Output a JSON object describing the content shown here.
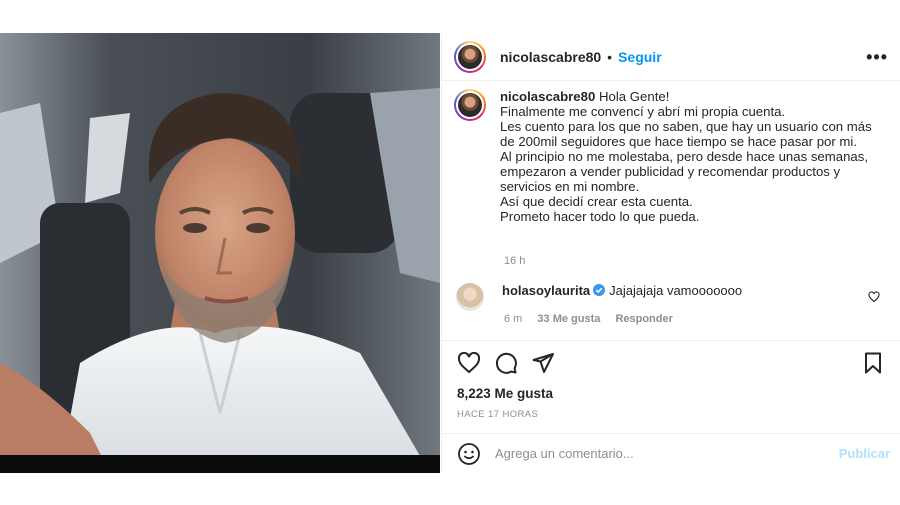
{
  "post": {
    "username": "nicolascabre80",
    "follow_label": "Seguir",
    "more_label": "•••",
    "separator": "•",
    "caption": {
      "username": "nicolascabre80",
      "lines": [
        "Hola Gente!",
        "Finalmente me convencí y abrí mi propia cuenta.",
        "Les cuento para los que no saben, que hay un usuario con más de 200mil seguidores que hace tiempo se hace pasar por mi.",
        "Al principio no me molestaba, pero desde hace unas semanas, empezaron a vender publicidad y recomendar productos y servicios en mi nombre.",
        "Así que decidí crear esta cuenta.",
        "Prometo hacer todo lo que pueda."
      ],
      "time": "16 h"
    },
    "comment": {
      "username": "holasoylaurita",
      "text": "Jajajajaja vamooooooo",
      "time": "6 m",
      "likes": "33 Me gusta",
      "reply_label": "Responder"
    },
    "likes_count": "8,223 Me gusta",
    "posted_ago": "HACE 17 HORAS",
    "add_comment_placeholder": "Agrega un comentario...",
    "publish_label": "Publicar"
  },
  "icons": {
    "header_more": "more-options-icon",
    "verified": "verified-badge-icon",
    "comment_like": "heart-icon",
    "like": "heart-icon",
    "comment": "comment-icon",
    "share": "paper-plane-icon",
    "save": "bookmark-icon",
    "emoji": "emoji-icon"
  },
  "colors": {
    "link_blue": "#0095f6",
    "publish_disabled": "#b2dffc",
    "muted_text": "#8e8e8e",
    "verified_blue": "#3897f0"
  }
}
